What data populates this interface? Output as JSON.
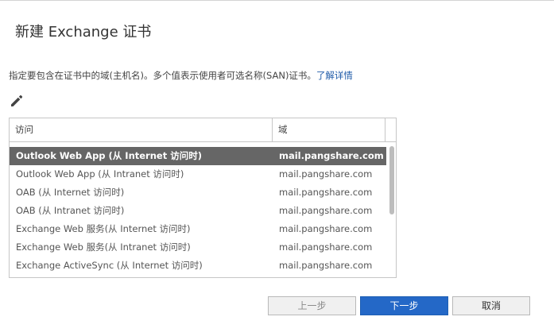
{
  "dialog": {
    "title": "新建 Exchange 证书",
    "description": "指定要包含在证书中的域(主机名)。多个值表示使用者可选名称(SAN)证书。",
    "learn_more": "了解详情"
  },
  "toolbar": {
    "edit_icon": "pencil-icon"
  },
  "table": {
    "columns": [
      "访问",
      "域"
    ],
    "rows": [
      {
        "access": "Outlook Web App (从 Internet 访问时)",
        "domain": "mail.pangshare.com",
        "selected": true
      },
      {
        "access": "Outlook Web App (从 Intranet 访问时)",
        "domain": "mail.pangshare.com"
      },
      {
        "access": "OAB (从 Internet 访问时)",
        "domain": "mail.pangshare.com"
      },
      {
        "access": "OAB (从 Intranet 访问时)",
        "domain": "mail.pangshare.com"
      },
      {
        "access": "Exchange Web 服务(从 Internet 访问时)",
        "domain": "mail.pangshare.com"
      },
      {
        "access": "Exchange Web 服务(从 Intranet 访问时)",
        "domain": "mail.pangshare.com"
      },
      {
        "access": "Exchange ActiveSync (从 Internet 访问时)",
        "domain": "mail.pangshare.com"
      }
    ]
  },
  "buttons": {
    "prev": "上一步",
    "next": "下一步",
    "cancel": "取消"
  },
  "colors": {
    "primary": "#2468c7",
    "link": "#1f5ba8",
    "selected_row": "#666666"
  }
}
